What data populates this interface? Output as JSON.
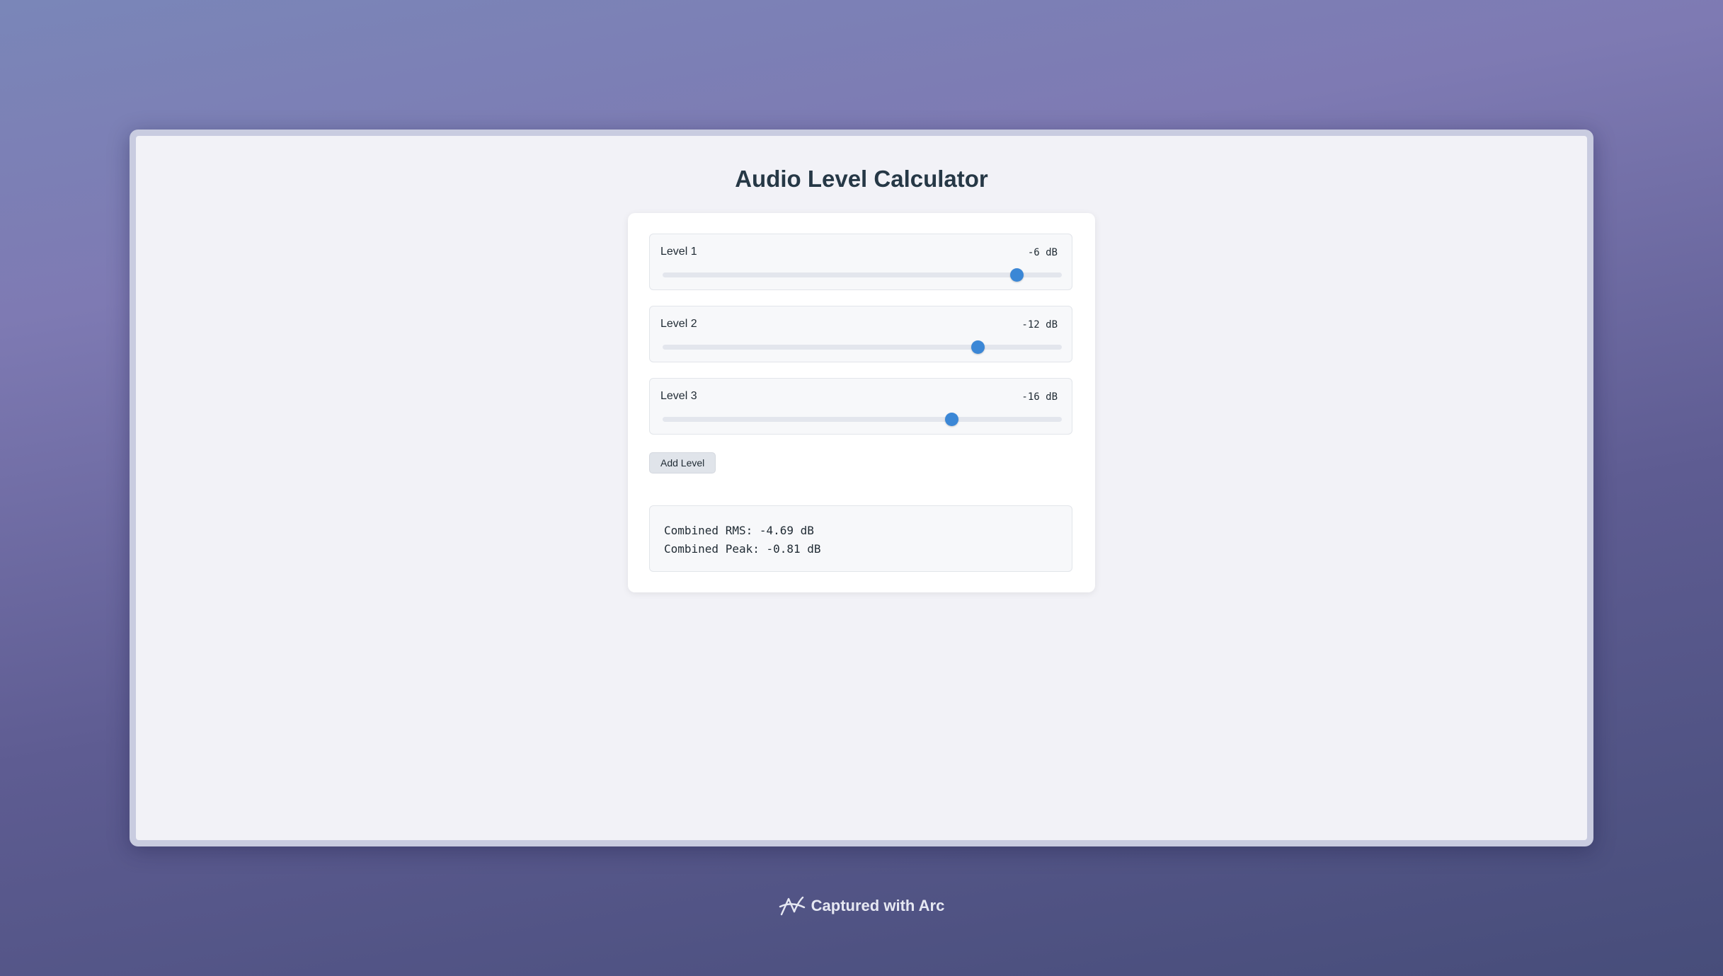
{
  "page_title": "Audio Level Calculator",
  "levels": [
    {
      "label": "Level 1",
      "value_text": "-6 dB",
      "fraction": 0.888
    },
    {
      "label": "Level 2",
      "value_text": "-12 dB",
      "fraction": 0.79
    },
    {
      "label": "Level 3",
      "value_text": "-16 dB",
      "fraction": 0.724
    }
  ],
  "add_button_label": "Add Level",
  "results": {
    "rms": "Combined RMS: -4.69 dB",
    "peak": "Combined Peak: -0.81 dB"
  },
  "footer": {
    "icon": "arc-logo-icon",
    "text": "Captured with Arc"
  },
  "colors": {
    "accent": "#3b87d6",
    "title": "#263846"
  }
}
